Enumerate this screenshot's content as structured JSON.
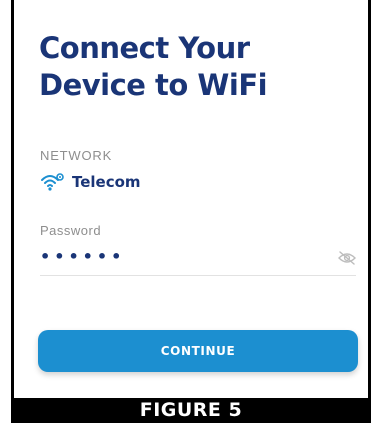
{
  "screen": {
    "title_line1": "Connect Your",
    "title_line2": "Device to WiFi"
  },
  "network": {
    "label": "NETWORK",
    "name": "Telecom",
    "icon": "wifi-icon"
  },
  "password": {
    "label": "Password",
    "masked_value": "••••••",
    "toggle_icon": "eye-off-icon"
  },
  "actions": {
    "continue_label": "CONTINUE"
  },
  "caption": {
    "text": "FIGURE 5"
  },
  "colors": {
    "title": "#1a3577",
    "accent_button": "#1c8fd0",
    "label": "#8e8e8e",
    "wifi_icon": "#1c8fd0"
  }
}
